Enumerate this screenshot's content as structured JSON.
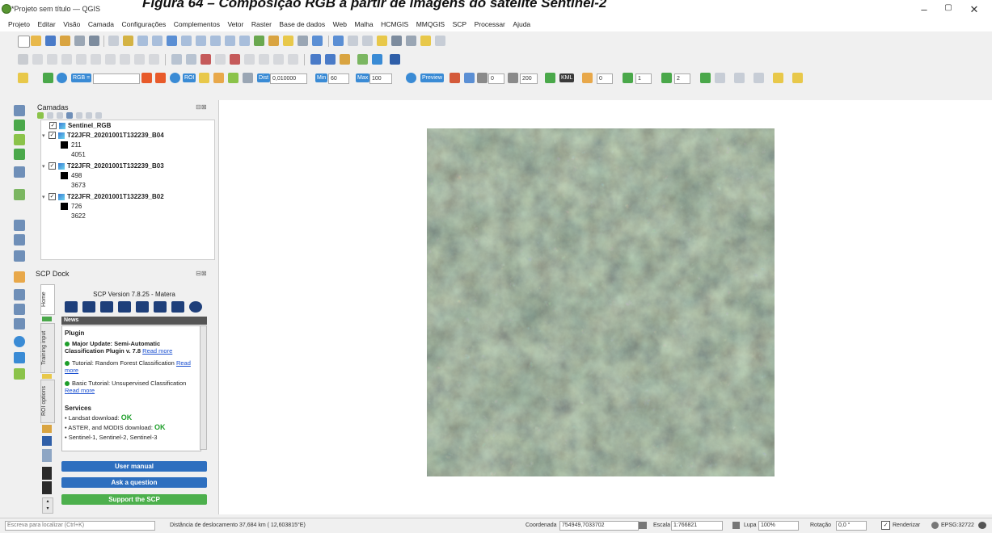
{
  "window": {
    "title": "*Projeto sem título — QGIS",
    "caption": "Figura 64 – Composição RGB a partir de imagens do satélite Sentinel-2",
    "minimize": "–",
    "maximize": "▢",
    "close": "✕"
  },
  "menu": [
    "Projeto",
    "Editar",
    "Visão",
    "Camada",
    "Configurações",
    "Complementos",
    "Vetor",
    "Raster",
    "Base de dados",
    "Web",
    "Malha",
    "HCMGIS",
    "MMQGIS",
    "SCP",
    "Processar",
    "Ajuda"
  ],
  "toolbar3": {
    "rgb_select": "RGB =",
    "roi_label": "ROI",
    "dist_label": "Dist",
    "dist_value": "0,010000",
    "min_label": "Min",
    "min_value": "60",
    "max_label": "Max",
    "max_value": "100",
    "preview_label": "Preview",
    "b0_value": "0",
    "s_value": "200",
    "kml_label": "KML",
    "v1": "0",
    "v2": "1",
    "v3": "2"
  },
  "layers_panel": {
    "title": "Camadas",
    "items": [
      {
        "name": "Sentinel_RGB",
        "check": "✓"
      },
      {
        "name": "T22JFR_20201001T132239_B04",
        "check": "✓",
        "min": "211",
        "max": "4051"
      },
      {
        "name": "T22JFR_20201001T132239_B03",
        "check": "✓",
        "min": "498",
        "max": "3673"
      },
      {
        "name": "T22JFR_20201001T132239_B02",
        "check": "✓",
        "min": "726",
        "max": "3622"
      }
    ]
  },
  "scp_dock": {
    "title": "SCP Dock",
    "vtabs": [
      "Home",
      "Training input",
      "ROI options"
    ],
    "version": "SCP Version 7.8.25 - Matera",
    "news_label": "News",
    "plugin_heading": "Plugin",
    "news1_bold": "Major Update: Semi-Automatic Classification Plugin v. 7.8",
    "news1_link": "Read more",
    "news2": "Tutorial: Random Forest Classification",
    "news2_link": "Read more",
    "news3": "Basic Tutorial: Unsupervised Classification",
    "news3_link": "Read more",
    "services_heading": "Services",
    "svc1": "• Landsat download:",
    "svc1_status": "OK",
    "svc2": "• ASTER, and MODIS download:",
    "svc2_status": "OK",
    "svc3": "• Sentinel-1, Sentinel-2, Sentinel-3",
    "btn_manual": "User manual",
    "btn_question": "Ask a question",
    "btn_support": "Support the SCP"
  },
  "statusbar": {
    "search_placeholder": "Escreva para localizar (Ctrl+K)",
    "distance": "Distância de deslocamento 37,684 km ( 12,603815°E)",
    "coord_label": "Coordenada",
    "coord_value": "754949,7033702",
    "scale_label": "Escala",
    "scale_value": "1:766821",
    "magnifier_label": "Lupa",
    "magnifier_value": "100%",
    "rotation_label": "Rotação",
    "rotation_value": "0,0 °",
    "render_label": "Renderizar",
    "crs": "EPSG:32722"
  }
}
